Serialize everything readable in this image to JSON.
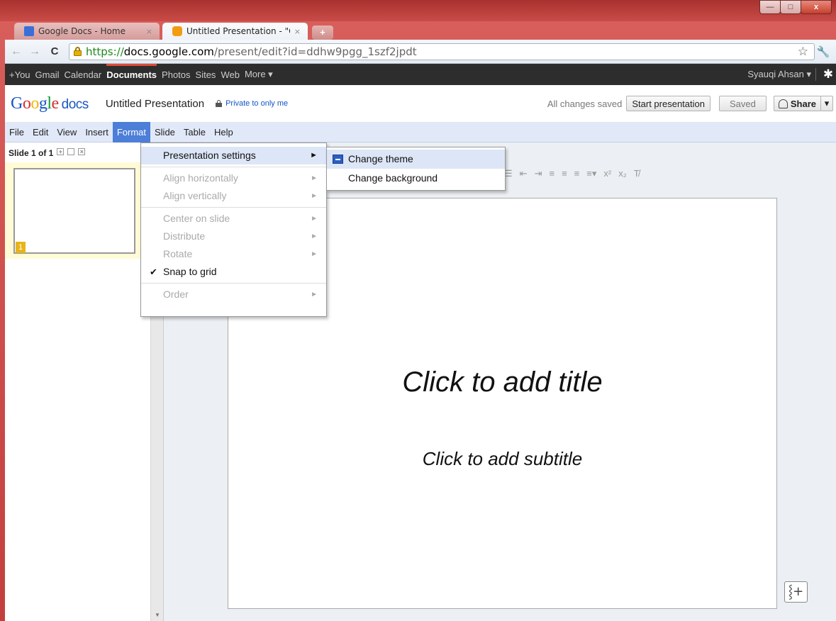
{
  "window": {
    "controls": {
      "minimize": "—",
      "maximize": "□",
      "close": "x"
    }
  },
  "tabs": [
    {
      "label": "Google Docs - Home",
      "close": "×",
      "icon": "docs-favicon"
    },
    {
      "label": "Untitled Presentation - \"Goo",
      "close": "×",
      "icon": "presentation-favicon"
    }
  ],
  "newtab_label": "+",
  "address_bar": {
    "scheme": "https://",
    "host": "docs.google.com",
    "path": "/present/edit?id=ddhw9pgg_1szf2jpdt"
  },
  "google_bar": {
    "links": [
      "+You",
      "Gmail",
      "Calendar",
      "Documents",
      "Photos",
      "Sites",
      "Web",
      "More ▾"
    ],
    "active": "Documents",
    "user": "Syauqi Ahsan ▾"
  },
  "header": {
    "logo_google": "Google",
    "logo_docs": "docs",
    "doc_title": "Untitled Presentation",
    "privacy": "Private to only me",
    "save_status": "All changes saved",
    "start_presentation": "Start presentation",
    "saved_button": "Saved",
    "share_button": "Share",
    "share_dropdown": "▾"
  },
  "menubar": [
    "File",
    "Edit",
    "View",
    "Insert",
    "Format",
    "Slide",
    "Table",
    "Help"
  ],
  "open_menu": "Format",
  "filmstrip": {
    "slide_count": "Slide 1 of 1",
    "slide_number": "1"
  },
  "format_menu": {
    "items": [
      {
        "label": "Presentation settings",
        "state": "hover",
        "submenu": true
      },
      {
        "label": "Align horizontally",
        "state": "disabled",
        "submenu": true
      },
      {
        "label": "Align vertically",
        "state": "disabled",
        "submenu": true
      },
      {
        "label": "Center on slide",
        "state": "disabled",
        "submenu": true
      },
      {
        "label": "Distribute",
        "state": "disabled",
        "submenu": true
      },
      {
        "label": "Rotate",
        "state": "disabled",
        "submenu": true
      },
      {
        "label": "Snap to grid",
        "state": "checked",
        "submenu": false
      },
      {
        "label": "Order",
        "state": "disabled",
        "submenu": true
      }
    ]
  },
  "submenu": {
    "items": [
      {
        "label": "Change theme",
        "icon": "theme-icon"
      },
      {
        "label": "Change background"
      }
    ]
  },
  "slide": {
    "title_placeholder": "Click to add title",
    "subtitle_placeholder": "Click to add subtitle"
  },
  "colors": {
    "window_frame": "#c94a48",
    "menubar_bg": "#e1e9f8",
    "menu_open": "#4d7ed8",
    "gbar_bg": "#2d2d2d",
    "accent_red": "#dd4b39",
    "filmstrip_highlight": "#fffbd6"
  }
}
